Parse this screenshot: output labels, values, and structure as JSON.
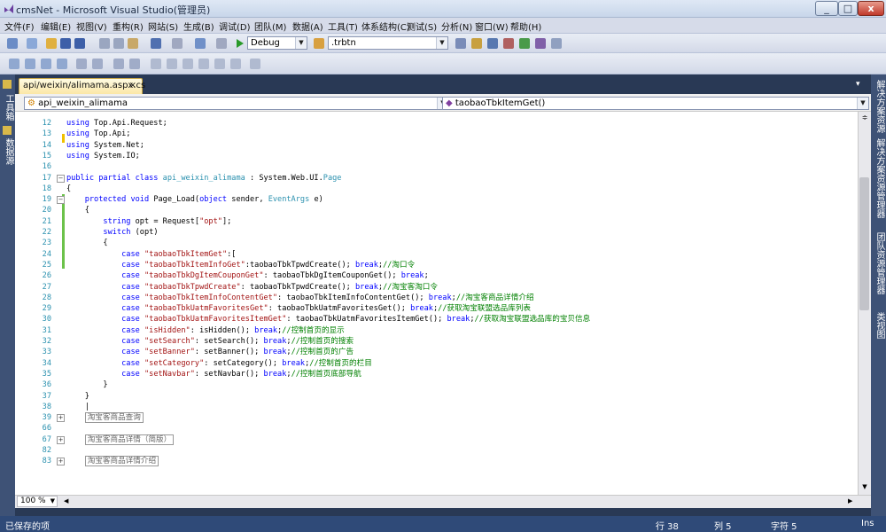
{
  "window": {
    "title": "cmsNet - Microsoft Visual Studio(管理员)",
    "minimize": "_",
    "maximize": "□",
    "close": "x"
  },
  "menu": [
    "文件(F)",
    "编辑(E)",
    "视图(V)",
    "重构(R)",
    "网站(S)",
    "生成(B)",
    "调试(D)",
    "团队(M)",
    "数据(A)",
    "工具(T)",
    "体系结构(C)",
    "测试(S)",
    "分析(N)",
    "窗口(W)",
    "帮助(H)"
  ],
  "toolbar": {
    "config": "Debug",
    "search": ".trbtn"
  },
  "tab": {
    "label": "api/weixin/alimama.aspx.cs",
    "close": "×"
  },
  "nav": {
    "class": "api_weixin_alimama",
    "member": "taobaoTbkItemGet()"
  },
  "left_panels": [
    "工具箱",
    "数据源"
  ],
  "right_panels": [
    "解决方案资源",
    "解决方案资源管理器",
    "团队资源管理器",
    "类视图"
  ],
  "editor": {
    "lines": [
      {
        "n": "12",
        "html": "<span class='kw'>using</span> Top.Api.Request;"
      },
      {
        "n": "13",
        "html": "<span class='kw'>using</span> Top.Api;"
      },
      {
        "n": "14",
        "html": "<span class='kw'>using</span> System.Net;"
      },
      {
        "n": "15",
        "html": "<span class='kw'>using</span> System.IO;"
      },
      {
        "n": "16",
        "html": ""
      },
      {
        "n": "17",
        "html": "<span class='kw'>public partial class</span> <span class='typ'>api_weixin_alimama</span> : System.Web.UI.<span class='typ'>Page</span>"
      },
      {
        "n": "18",
        "html": "{"
      },
      {
        "n": "19",
        "html": "    <span class='kw'>protected void</span> Page_Load(<span class='kw'>object</span> sender, <span class='typ'>EventArgs</span> e)"
      },
      {
        "n": "20",
        "html": "    {"
      },
      {
        "n": "21",
        "html": "        <span class='kw'>string</span> opt = Request[<span class='str'>\"opt\"</span>];"
      },
      {
        "n": "22",
        "html": "        <span class='kw'>switch</span> (opt)"
      },
      {
        "n": "23",
        "html": "        {"
      },
      {
        "n": "24",
        "html": "            <span class='kw'>case</span> <span class='str'>\"taobaoTbkItemGet\"</span>:["
      },
      {
        "n": "25",
        "html": "            <span class='kw'>case</span> <span class='str'>\"taobaoTbkItemInfoGet\"</span>:taobaoTbkTpwdCreate(); <span class='kw'>break</span>;<span class='cmt'>//淘口令</span>"
      },
      {
        "n": "26",
        "html": "            <span class='kw'>case</span> <span class='str'>\"taobaoTbkDgItemCouponGet\"</span>: taobaoTbkDgItemCouponGet(); <span class='kw'>break</span>;"
      },
      {
        "n": "27",
        "html": "            <span class='kw'>case</span> <span class='str'>\"taobaoTbkTpwdCreate\"</span>: taobaoTbkTpwdCreate(); <span class='kw'>break</span>;<span class='cmt'>//淘宝客淘口令</span>"
      },
      {
        "n": "28",
        "html": "            <span class='kw'>case</span> <span class='str'>\"taobaoTbkItemInfoContentGet\"</span>: taobaoTbkItemInfoContentGet(); <span class='kw'>break</span>;<span class='cmt'>//淘宝客商品详情介绍</span>"
      },
      {
        "n": "29",
        "html": "            <span class='kw'>case</span> <span class='str'>\"taobaoTbkUatmFavoritesGet\"</span>: taobaoTbkUatmFavoritesGet(); <span class='kw'>break</span>;<span class='cmt'>//获取淘宝联盟选品库列表</span>"
      },
      {
        "n": "30",
        "html": "            <span class='kw'>case</span> <span class='str'>\"taobaoTbkUatmFavoritesItemGet\"</span>: taobaoTbkUatmFavoritesItemGet(); <span class='kw'>break</span>;<span class='cmt'>//获取淘宝联盟选品库的宝贝信息</span>"
      },
      {
        "n": "31",
        "html": "            <span class='kw'>case</span> <span class='str'>\"isHidden\"</span>: isHidden(); <span class='kw'>break</span>;<span class='cmt'>//控制首页的显示</span>"
      },
      {
        "n": "32",
        "html": "            <span class='kw'>case</span> <span class='str'>\"setSearch\"</span>: setSearch(); <span class='kw'>break</span>;<span class='cmt'>//控制首页的搜索</span>"
      },
      {
        "n": "33",
        "html": "            <span class='kw'>case</span> <span class='str'>\"setBanner\"</span>: setBanner(); <span class='kw'>break</span>;<span class='cmt'>//控制首页的广告</span>"
      },
      {
        "n": "34",
        "html": "            <span class='kw'>case</span> <span class='str'>\"setCategory\"</span>: setCategory(); <span class='kw'>break</span>;<span class='cmt'>//控制首页的栏目</span>"
      },
      {
        "n": "35",
        "html": "            <span class='kw'>case</span> <span class='str'>\"setNavbar\"</span>: setNavbar(); <span class='kw'>break</span>;<span class='cmt'>//控制首页底部导航</span>"
      },
      {
        "n": "36",
        "html": "        }"
      },
      {
        "n": "37",
        "html": "    }"
      },
      {
        "n": "38",
        "html": "    |"
      },
      {
        "n": "39",
        "html": "    <span class='region'>淘宝客商品查询</span>"
      },
      {
        "n": "66",
        "html": ""
      },
      {
        "n": "67",
        "html": "    <span class='region'>淘宝客商品详情（简版）</span>"
      },
      {
        "n": "82",
        "html": ""
      },
      {
        "n": "83",
        "html": "    <span class='region'>淘宝客商品详情介绍</span>"
      }
    ]
  },
  "zoom": "100 %",
  "status": {
    "left": "已保存的项",
    "row": "行 38",
    "col": "列 5",
    "char": "字符 5",
    "mode": "Ins"
  }
}
